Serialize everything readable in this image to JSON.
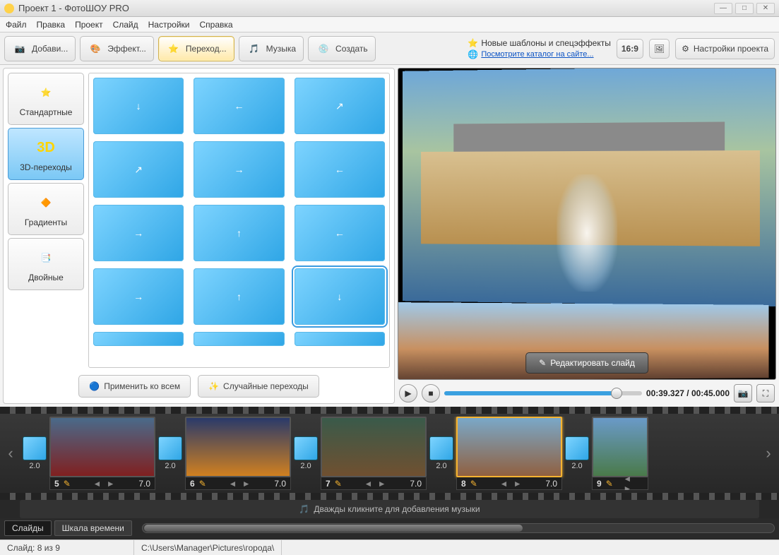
{
  "window": {
    "title": "Проект 1 - ФотоШОУ PRO"
  },
  "menu": [
    "Файл",
    "Правка",
    "Проект",
    "Слайд",
    "Настройки",
    "Справка"
  ],
  "toolbar_tabs": [
    {
      "label": "Добави...",
      "icon": "camera"
    },
    {
      "label": "Эффект...",
      "icon": "palette"
    },
    {
      "label": "Переход...",
      "icon": "star",
      "active": true
    },
    {
      "label": "Музыка",
      "icon": "music"
    },
    {
      "label": "Создать",
      "icon": "disc"
    }
  ],
  "banner": {
    "templates_line": "Новые шаблоны и спецэффекты",
    "catalog_link": "Посмотрите каталог на сайте..."
  },
  "aspect_label": "16:9",
  "project_settings_label": "Настройки проекта",
  "categories": [
    {
      "label": "Стандартные",
      "icon": "star"
    },
    {
      "label": "3D-переходы",
      "icon": "3d",
      "active": true
    },
    {
      "label": "Градиенты",
      "icon": "gradient"
    },
    {
      "label": "Двойные",
      "icon": "double"
    }
  ],
  "left_actions": {
    "apply_all": "Применить ко всем",
    "random": "Случайные переходы"
  },
  "preview": {
    "edit_slide": "Редактировать слайд",
    "time": "00:39.327 / 00:45.000"
  },
  "timeline": {
    "slides": [
      {
        "num": "5",
        "dur": "7.0",
        "trans": "2.0"
      },
      {
        "num": "6",
        "dur": "7.0",
        "trans": "2.0"
      },
      {
        "num": "7",
        "dur": "7.0",
        "trans": "2.0"
      },
      {
        "num": "8",
        "dur": "7.0",
        "trans": "2.0",
        "selected": true
      },
      {
        "num": "9",
        "dur": "",
        "trans": "2.0"
      }
    ],
    "music_hint": "Дважды кликните для добавления музыки",
    "tabs": {
      "slides": "Слайды",
      "timeline": "Шкала времени"
    }
  },
  "statusbar": {
    "slide": "Слайд: 8 из 9",
    "path": "C:\\Users\\Manager\\Pictures\\города\\"
  }
}
